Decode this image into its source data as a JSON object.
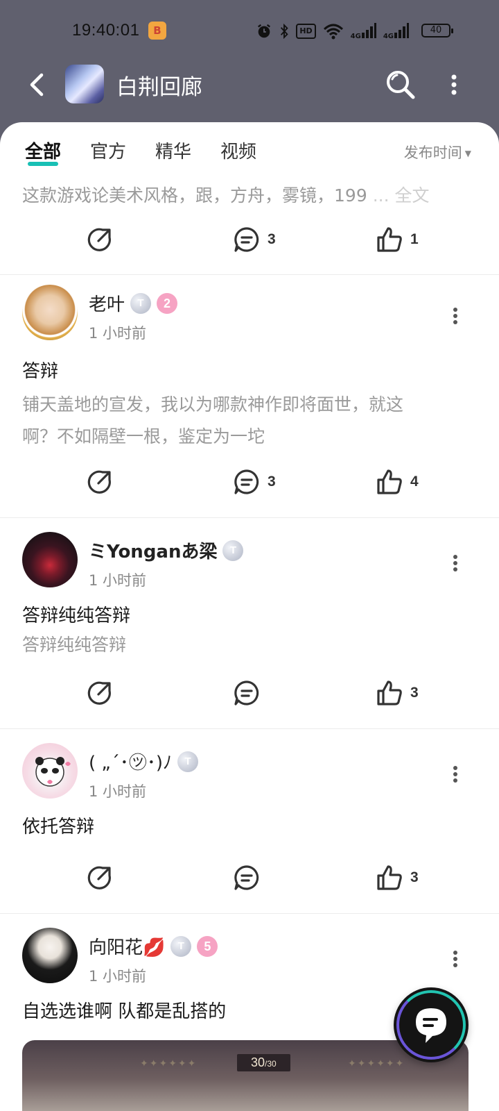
{
  "status_bar": {
    "time": "19:40:01",
    "app_badge": "B",
    "battery": "40",
    "signal1": "4G",
    "signal2": "4G",
    "hd": "HD"
  },
  "header": {
    "title": "白荆回廊"
  },
  "tabs": [
    {
      "label": "全部",
      "active": true
    },
    {
      "label": "官方",
      "active": false
    },
    {
      "label": "精华",
      "active": false
    },
    {
      "label": "视频",
      "active": false
    }
  ],
  "sort": {
    "label": "发布时间"
  },
  "preview_post": {
    "text": "这款游戏论美术风格，跟，方舟，雾镜，199",
    "more_label": "... 全文",
    "comments": "3",
    "likes": "1"
  },
  "posts": [
    {
      "username": "老叶",
      "time": "1 小时前",
      "badge_t": "T",
      "level": "2",
      "title": "答辩",
      "body_line1": "铺天盖地的宣发，我以为哪款神作即将面世，就这",
      "body_line2": "啊？不如隔壁一根，鉴定为一坨",
      "comments": "3",
      "likes": "4"
    },
    {
      "username": "ミYonganあ梁",
      "time": "1 小时前",
      "badge_t": "T",
      "title": "答辩纯纯答辩",
      "body": "答辩纯纯答辩",
      "likes": "3"
    },
    {
      "username": "( „´･㋡･)ﾉ",
      "time": "1 小时前",
      "badge_t": "T",
      "title": "依托答辩",
      "likes": "3"
    },
    {
      "username": "向阳花💋",
      "time": "1 小时前",
      "badge_t": "T",
      "level": "5",
      "title": "自选选谁啊 队都是乱搭的",
      "media_counter": "30",
      "media_counter_total": "/30"
    }
  ],
  "colors": {
    "accent": "#19c0b5",
    "header_bg": "#60606e"
  }
}
